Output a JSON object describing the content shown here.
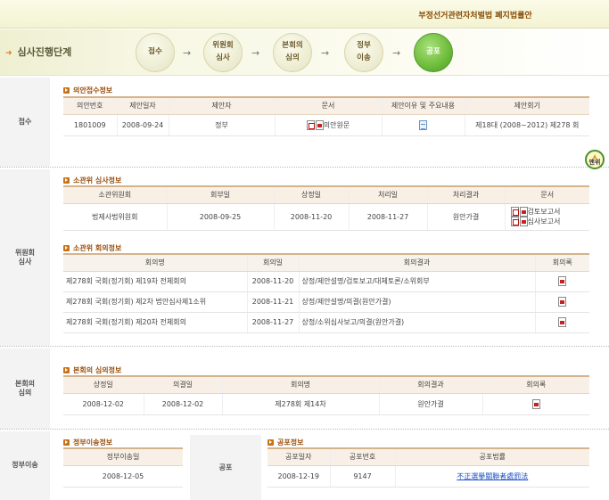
{
  "header": {
    "title": "부정선거관련자처벌법 폐지법률안"
  },
  "stages": {
    "label": "심사진행단계",
    "steps": [
      {
        "line1": "접수",
        "line2": ""
      },
      {
        "line1": "위원회",
        "line2": "심사"
      },
      {
        "line1": "본회의",
        "line2": "심의"
      },
      {
        "line1": "정부",
        "line2": "이송"
      },
      {
        "line1": "공포",
        "line2": ""
      }
    ],
    "arrow": "→",
    "active_index": 4
  },
  "receipt": {
    "section_label": "접수",
    "title": "의안접수정보",
    "columns": [
      "의안번호",
      "제안일자",
      "제안자",
      "문서",
      "제안이유 및 주요내용",
      "제안회기"
    ],
    "row": {
      "bill_no": "1801009",
      "date": "2008-09-24",
      "proposer": "정부",
      "doc": "의안원문",
      "session": "제18대 (2008~2012) 제278 회"
    }
  },
  "top_button": {
    "label": "맨위"
  },
  "committee": {
    "section_label_1": "위원회",
    "section_label_2": "심사",
    "review_title": "소관위 심사정보",
    "review_columns": [
      "소관위원회",
      "회부일",
      "상정일",
      "처리일",
      "처리결과",
      "문서"
    ],
    "review_row": {
      "committee": "법제사법위원회",
      "referred": "2008-09-25",
      "presented": "2008-11-20",
      "processed": "2008-11-27",
      "result": "원안가결",
      "doc1": "검토보고서",
      "doc2": "심사보고서"
    },
    "meeting_title": "소관위 회의정보",
    "meeting_columns": [
      "회의명",
      "회의일",
      "회의결과",
      "회의록"
    ],
    "meetings": [
      {
        "name": "제278회 국회(정기회) 제19차 전체회의",
        "date": "2008-11-20",
        "result": "상정/제안설명/검토보고/대체토론/소위회부"
      },
      {
        "name": "제278회 국회(정기회) 제2차 법안심사제1소위",
        "date": "2008-11-21",
        "result": "상정/제안설명/의결(원안가결)"
      },
      {
        "name": "제278회 국회(정기회) 제20차 전체회의",
        "date": "2008-11-27",
        "result": "상정/소위심사보고/의결(원안가결)"
      }
    ]
  },
  "plenary": {
    "section_label_1": "본회의",
    "section_label_2": "심의",
    "title": "본회의 심의정보",
    "columns": [
      "상정일",
      "의결일",
      "회의명",
      "회의결과",
      "회의록"
    ],
    "row": {
      "presented": "2008-12-02",
      "resolved": "2008-12-02",
      "meeting": "제278회 제14차",
      "result": "원안가결"
    }
  },
  "transfer": {
    "section_label": "정부이송",
    "title": "정부이송정보",
    "columns": [
      "정부이송일"
    ],
    "row": {
      "date": "2008-12-05"
    }
  },
  "promulgation": {
    "section_label": "공포",
    "title": "공포정보",
    "columns": [
      "공포일자",
      "공포번호",
      "공포법률"
    ],
    "row": {
      "date": "2008-12-19",
      "number": "9147",
      "law": "不正選擧關聯者處罰法"
    }
  }
}
